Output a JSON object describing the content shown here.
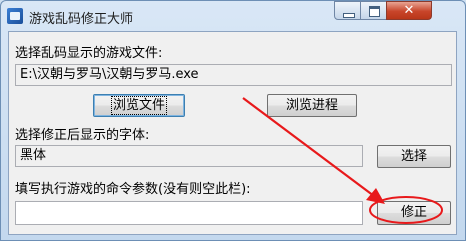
{
  "window": {
    "title": "游戏乱码修正大师"
  },
  "form": {
    "game_file_label": "选择乱码显示的游戏文件:",
    "game_file_value": "E:\\汉朝与罗马\\汉朝与罗马.exe",
    "browse_file_button": "浏览文件",
    "browse_process_button": "浏览进程",
    "font_label": "选择修正后显示的字体:",
    "font_value": "黑体",
    "select_button": "选择",
    "params_label": "填写执行游戏的命令参数(没有则空此栏):",
    "params_value": "",
    "fix_button": "修正"
  },
  "annotation": {
    "arrow_color": "#e8191b"
  }
}
